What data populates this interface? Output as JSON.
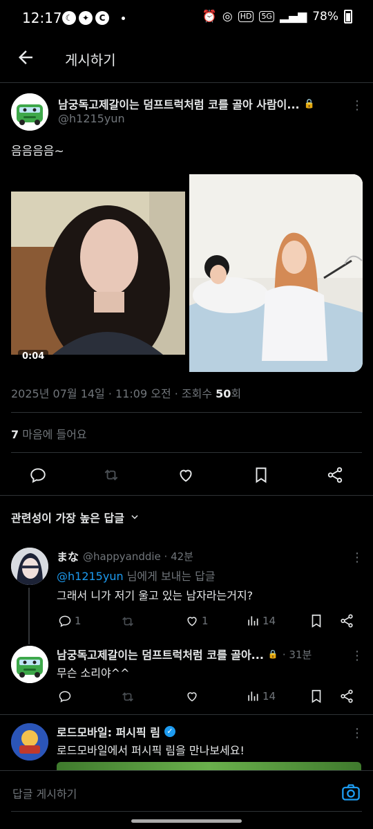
{
  "status": {
    "time": "12:17",
    "battery": "78%",
    "left_badges": [
      "C",
      "C"
    ],
    "net_badges": [
      "HD",
      "5G"
    ]
  },
  "header": {
    "title": "게시하기"
  },
  "post": {
    "author_name": "남궁독고제갈이는 덤프트럭처럼 코를 골아 사람이...",
    "handle": "@h1215yun",
    "text": "음음음음~",
    "video_duration": "0:04",
    "meta_prefix": "2025년 07월 14일 · 11:09 오전 · 조회수 ",
    "views": "50",
    "views_suffix": "회",
    "likes_count": "7",
    "likes_label": " 마음에 들어요"
  },
  "sort": {
    "label": "관련성이 가장 높은 답글"
  },
  "replies": [
    {
      "name": "まな",
      "handle_time": "@happyanddie · 42분",
      "mention": "@h1215yun",
      "mention_suffix": " 님에게 보내는 답글",
      "text": "그래서 니가 저기 울고 있는 남자라는거지?",
      "reply_count": "1",
      "like_count": "1",
      "views": "14"
    },
    {
      "name": "남궁독고제갈이는 덤프트럭처럼 코를 골아...",
      "handle_time": "· 31분",
      "text": "무슨 소리야^^",
      "views": "14"
    }
  ],
  "ad": {
    "name": "로드모바일: 퍼시픽 림",
    "text": "로드모바일에서 퍼시픽 림을 만나보세요!"
  },
  "composer": {
    "placeholder": "답글 게시하기"
  },
  "colors": {
    "accent": "#1d9bf0",
    "muted": "#71767b",
    "bg": "#000000"
  }
}
